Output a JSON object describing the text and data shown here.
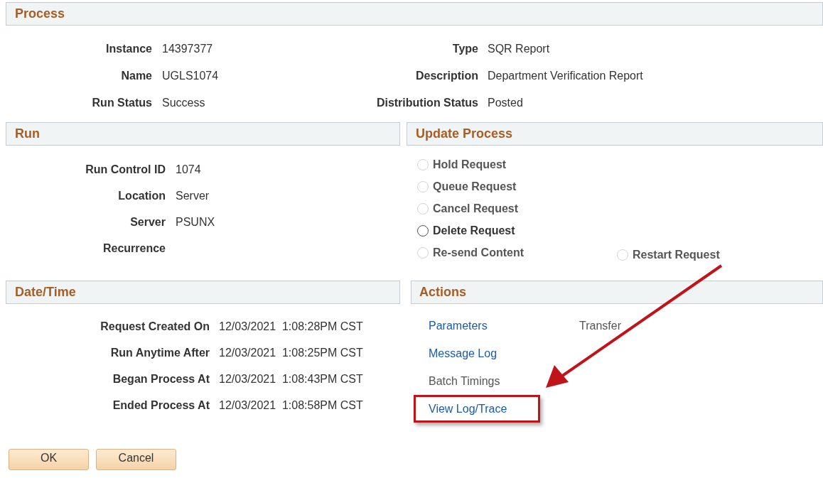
{
  "process": {
    "title": "Process",
    "left_fields": [
      {
        "label": "Instance",
        "value": "14397377"
      },
      {
        "label": "Name",
        "value": "UGLS1074"
      },
      {
        "label": "Run Status",
        "value": "Success"
      }
    ],
    "right_fields": [
      {
        "label": "Type",
        "value": "SQR Report"
      },
      {
        "label": "Description",
        "value": "Department Verification Report"
      },
      {
        "label": "Distribution Status",
        "value": "Posted"
      }
    ]
  },
  "run": {
    "title": "Run",
    "fields": [
      {
        "label": "Run Control ID",
        "value": "1074"
      },
      {
        "label": "Location",
        "value": "Server"
      },
      {
        "label": "Server",
        "value": "PSUNX"
      },
      {
        "label": "Recurrence"
      }
    ]
  },
  "update_process": {
    "title": "Update Process",
    "options": [
      {
        "label": "Hold Request",
        "disabled": true,
        "selected": false
      },
      {
        "label": "Queue Request",
        "disabled": true,
        "selected": false
      },
      {
        "label": "Cancel Request",
        "disabled": true,
        "selected": false
      },
      {
        "label": "Delete Request",
        "disabled": false,
        "selected": false
      },
      {
        "label": "Re-send Content",
        "disabled": true,
        "selected": false
      }
    ],
    "side_option": {
      "label": "Restart Request",
      "disabled": true,
      "selected": false
    }
  },
  "date_time": {
    "title": "Date/Time",
    "fields": [
      {
        "label": "Request Created On",
        "value": "12/03/2021  1:08:28PM CST"
      },
      {
        "label": "Run Anytime After",
        "value": "12/03/2021  1:08:25PM CST"
      },
      {
        "label": "Began Process At",
        "value": "12/03/2021  1:08:43PM CST"
      },
      {
        "label": "Ended Process At",
        "value": "12/03/2021  1:08:58PM CST"
      }
    ]
  },
  "actions": {
    "title": "Actions",
    "items": [
      {
        "label": "Parameters",
        "kind": "link",
        "highlighted": false
      },
      {
        "label": "Message Log",
        "kind": "link",
        "highlighted": false
      },
      {
        "label": "Batch Timings",
        "kind": "text",
        "highlighted": false
      },
      {
        "label": "View Log/Trace",
        "kind": "link",
        "highlighted": true
      }
    ],
    "side_item": {
      "label": "Transfer",
      "kind": "text"
    }
  },
  "buttons": [
    "OK",
    "Cancel"
  ]
}
